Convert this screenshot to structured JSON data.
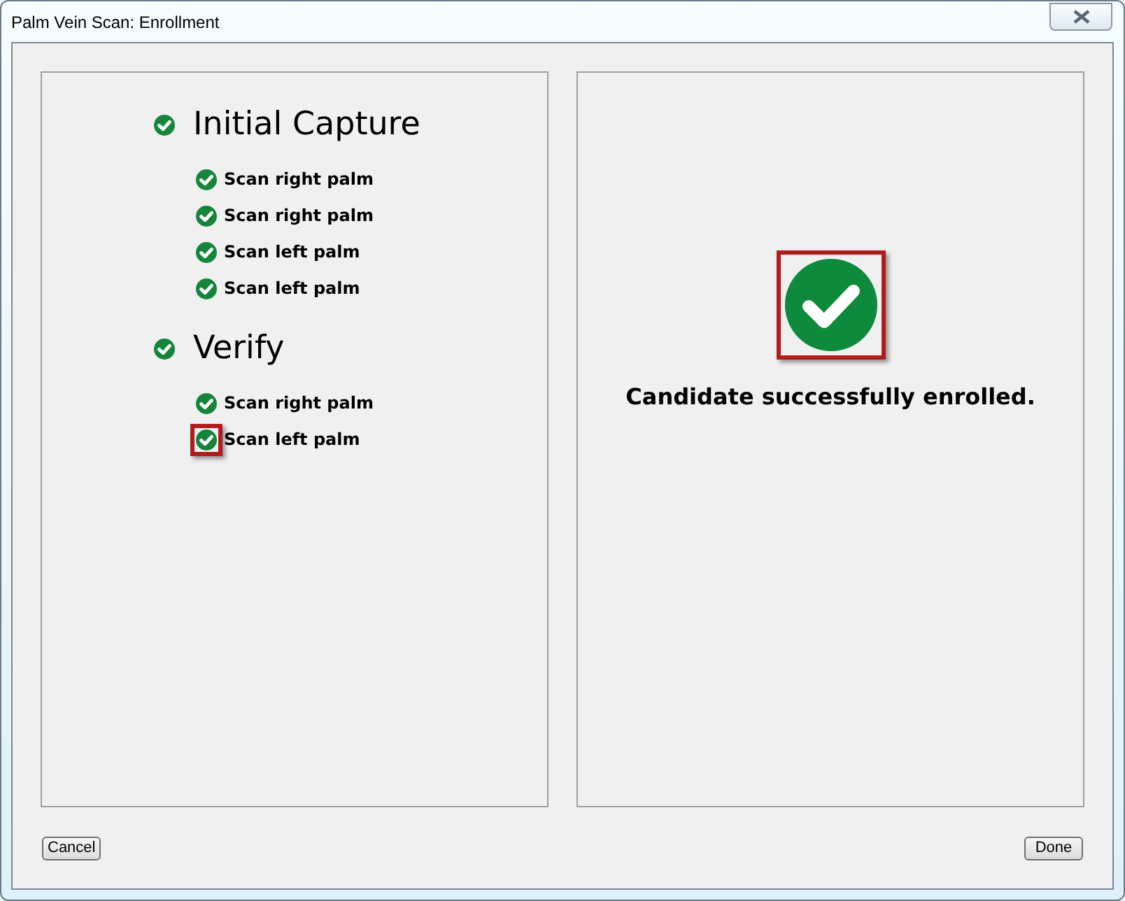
{
  "window": {
    "title": "Palm Vein Scan: Enrollment"
  },
  "sections": [
    {
      "title": "Initial Capture",
      "highlighted": false,
      "steps": [
        {
          "label": "Scan right palm",
          "highlighted": false
        },
        {
          "label": "Scan right palm",
          "highlighted": false
        },
        {
          "label": "Scan left palm",
          "highlighted": false
        },
        {
          "label": "Scan left palm",
          "highlighted": false
        }
      ]
    },
    {
      "title": "Verify",
      "highlighted": false,
      "steps": [
        {
          "label": "Scan right palm",
          "highlighted": false
        },
        {
          "label": "Scan left palm",
          "highlighted": true
        }
      ]
    }
  ],
  "result": {
    "message": "Candidate successfully enrolled.",
    "highlighted": true
  },
  "buttons": {
    "cancel": "Cancel",
    "done": "Done"
  }
}
